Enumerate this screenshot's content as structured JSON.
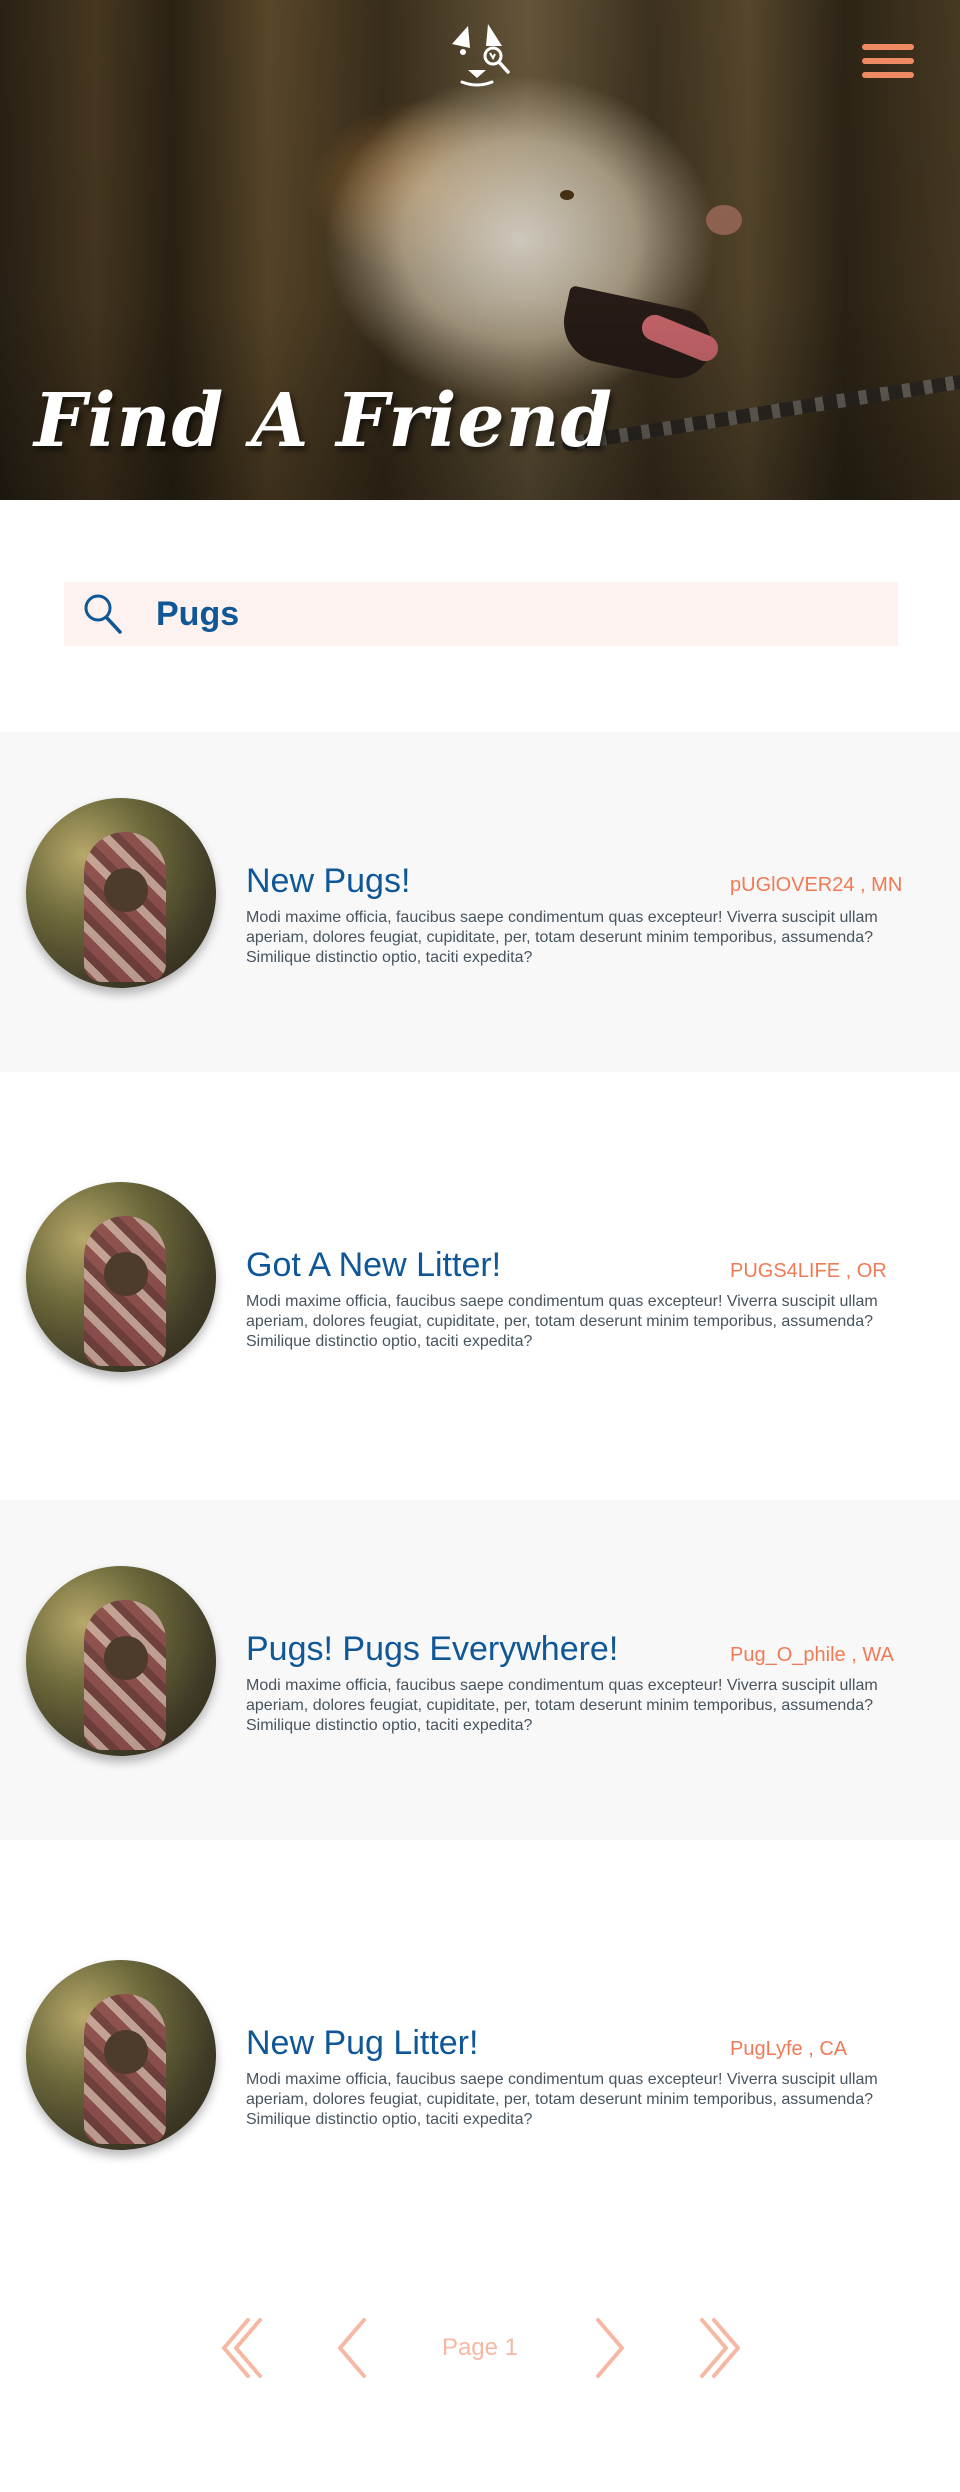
{
  "header": {
    "title": "Find A Friend",
    "logo_icon": "dog-magnifier-icon",
    "menu_icon": "hamburger-menu-icon"
  },
  "search": {
    "icon": "search-icon",
    "value": "Pugs"
  },
  "listings": [
    {
      "title": "New Pugs!",
      "user": "pUGlOVER24 , MN",
      "description": "Modi maxime officia, faucibus saepe condimentum quas excepteur! Viverra suscipit ullam aperiam, dolores feugiat, cupiditate, per, totam deserunt minim temporibus, assumenda? Similique distinctio optio, taciti expedita?"
    },
    {
      "title": "Got A New Litter!",
      "user": "PUGS4LIFE , OR",
      "description": "Modi maxime officia, faucibus saepe condimentum quas excepteur! Viverra suscipit ullam aperiam, dolores feugiat, cupiditate, per, totam deserunt minim temporibus, assumenda? Similique distinctio optio, taciti expedita?"
    },
    {
      "title": "Pugs! Pugs Everywhere!",
      "user": "Pug_O_phile , WA",
      "description": "Modi maxime officia, faucibus saepe condimentum quas excepteur! Viverra suscipit ullam aperiam, dolores feugiat, cupiditate, per, totam deserunt minim temporibus, assumenda? Similique distinctio optio, taciti expedita?"
    },
    {
      "title": "New Pug Litter!",
      "user": "PugLyfe , CA",
      "description": "Modi maxime officia, faucibus saepe condimentum quas excepteur! Viverra suscipit ullam aperiam, dolores feugiat, cupiditate, per, totam deserunt minim temporibus, assumenda? Similique distinctio optio, taciti expedita?"
    }
  ],
  "pagination": {
    "label": "Page 1",
    "first_icon": "double-chevron-left-icon",
    "prev_icon": "chevron-left-icon",
    "next_icon": "chevron-right-icon",
    "last_icon": "double-chevron-right-icon"
  },
  "colors": {
    "brand_blue": "#0f5796",
    "accent_orange": "#f07a55",
    "pager_peach": "#f6b8a2",
    "search_bg": "#fdf2ef"
  }
}
